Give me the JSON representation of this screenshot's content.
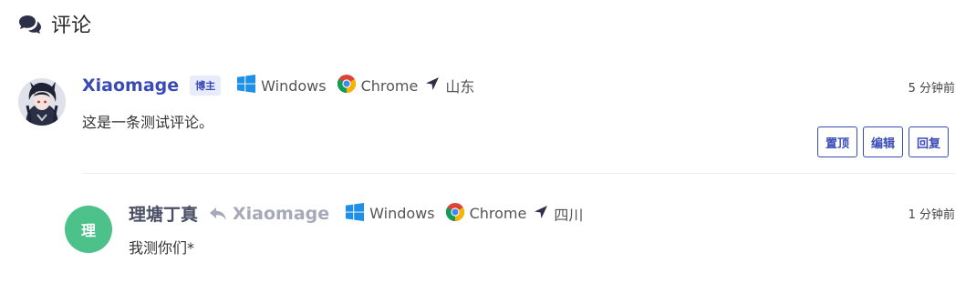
{
  "section": {
    "title": "评论",
    "icon": "comments-icon"
  },
  "comments": [
    {
      "author": "Xiaomage",
      "badge": "博主",
      "os": "Windows",
      "browser": "Chrome",
      "location": "山东",
      "time": "5 分钟前",
      "text": "这是一条测试评论。",
      "actions": [
        "置顶",
        "编辑",
        "回复"
      ]
    },
    {
      "author": "理塘丁真",
      "avatar_letter": "理",
      "reply_to": "Xiaomage",
      "os": "Windows",
      "browser": "Chrome",
      "location": "四川",
      "time": "1 分钟前",
      "text": "我测你们*"
    }
  ],
  "colors": {
    "accent": "#3a4bb5",
    "avatar_green": "#4cc189",
    "windows_blue": "#1e90e8"
  }
}
